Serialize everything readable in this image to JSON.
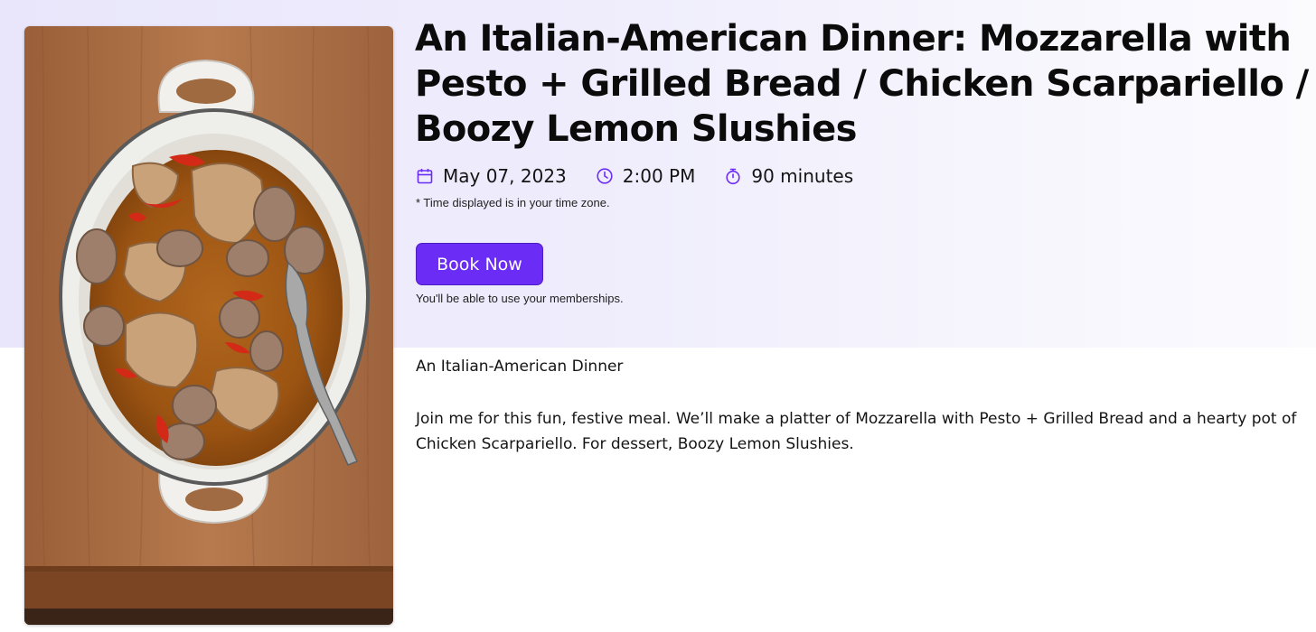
{
  "event": {
    "title": "An Italian-American Dinner: Mozzarella with Pesto + Grilled Bread / Chicken Scarpariello / Boozy Lemon Slushies",
    "date": "May 07, 2023",
    "time": "2:00 PM",
    "duration": "90 minutes",
    "timezone_note": "* Time displayed is in your time zone.",
    "book_label": "Book Now",
    "membership_note": "You'll be able to use your memberships."
  },
  "description": {
    "heading": "An Italian-American Dinner",
    "body": "Join me for this fun, festive meal. We’ll make a platter of Mozzarella with Pesto + Grilled Bread and a hearty pot of Chicken Scarpariello. For dessert, Boozy Lemon Slushies."
  },
  "icons": {
    "date": "calendar-icon",
    "time": "clock-icon",
    "duration": "stopwatch-icon"
  },
  "colors": {
    "accent": "#6b2cf5",
    "hero_band": "#ece9fb"
  }
}
